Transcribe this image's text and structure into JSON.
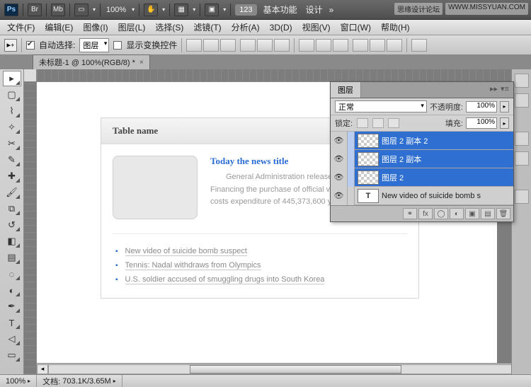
{
  "appbar": {
    "zoom": "100%",
    "chip": "123",
    "tab1": "基本功能",
    "tab2": "设计"
  },
  "watermark": {
    "a": "思缘设计论坛",
    "b": "WWW.MISSYUAN.COM"
  },
  "menu": [
    "文件(F)",
    "编辑(E)",
    "图像(I)",
    "图层(L)",
    "选择(S)",
    "滤镜(T)",
    "分析(A)",
    "3D(D)",
    "视图(V)",
    "窗口(W)",
    "帮助(H)"
  ],
  "options": {
    "auto_select": "自动选择:",
    "layer_sel": "图层",
    "show_transform": "显示变换控件"
  },
  "doc_tab": "未标题-1 @ 100%(RGB/8) *",
  "mock": {
    "table_name": "Table name",
    "news_title": "Today the news title",
    "news_body": "General Administration released the 2011 \"Three Financing the purchase of official vehicles and running costs expenditure of 445,373,600 yuan,",
    "links": [
      "New video of suicide bomb suspect",
      "Tennis: Nadal withdraws from Olympics",
      "U.S. soldier accused of smuggling drugs into South Korea"
    ]
  },
  "panel": {
    "tab": "图层",
    "blend_mode": "正常",
    "opacity_label": "不透明度:",
    "opacity_value": "100%",
    "lock_label": "锁定:",
    "fill_label": "填充:",
    "fill_value": "100%",
    "layers": [
      {
        "name": "图层 2 副本 2",
        "sel": true
      },
      {
        "name": "图层 2 副本",
        "sel": true
      },
      {
        "name": "图层 2",
        "sel": true
      },
      {
        "name": "New video of suicide bomb s",
        "sel": false,
        "type": "T"
      }
    ]
  },
  "status": {
    "zoom": "100%",
    "doc_label": "文档:",
    "doc_value": "703.1K/3.65M"
  }
}
